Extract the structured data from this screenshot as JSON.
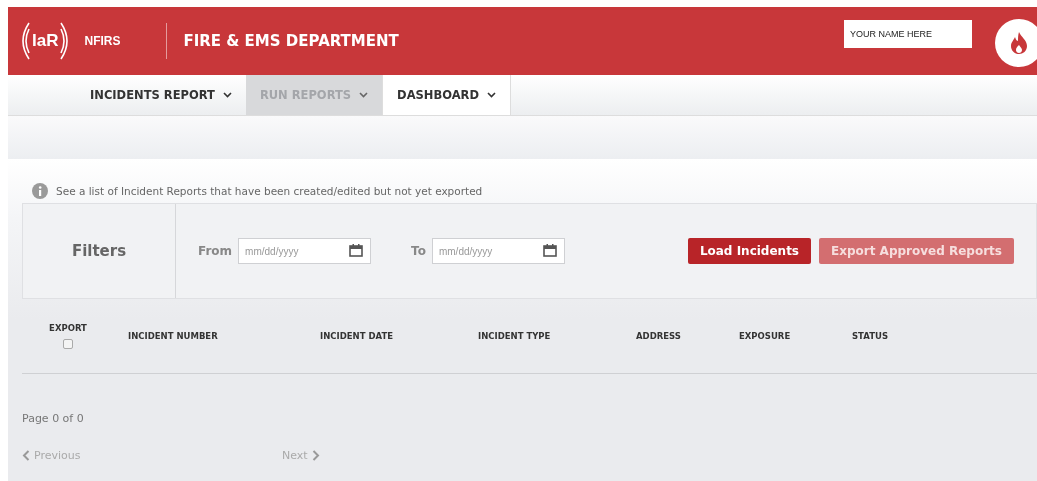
{
  "header": {
    "logo": "IaR",
    "product": "NFIRS",
    "department": "FIRE & EMS DEPARTMENT",
    "user_field": {
      "value": "YOUR NAME HERE"
    }
  },
  "nav": [
    {
      "label": "INCIDENTS REPORT",
      "selected": false,
      "disabled": false
    },
    {
      "label": "RUN REPORTS",
      "selected": false,
      "disabled": true
    },
    {
      "label": "DASHBOARD",
      "selected": true,
      "disabled": false
    }
  ],
  "info": "See a list of Incident Reports that have been created/edited but not yet exported",
  "filters": {
    "title": "Filters",
    "from": {
      "label": "From",
      "placeholder": "mm/dd/yyyy"
    },
    "to": {
      "label": "To",
      "placeholder": "mm/dd/yyyy"
    },
    "buttons": [
      {
        "label": "Load Incidents",
        "disabled": false
      },
      {
        "label": "Export Approved Reports",
        "disabled": true
      }
    ]
  },
  "table": {
    "export_column": {
      "label": "EXPORT",
      "checked": false
    },
    "columns": [
      "INCIDENT NUMBER",
      "INCIDENT DATE",
      "INCIDENT TYPE",
      "ADDRESS",
      "EXPOSURE",
      "STATUS"
    ]
  },
  "pagination": {
    "page": "Page 0 of 0",
    "previous": {
      "label": "Previous",
      "disabled": true
    },
    "next": {
      "label": "Next",
      "disabled": true
    }
  }
}
